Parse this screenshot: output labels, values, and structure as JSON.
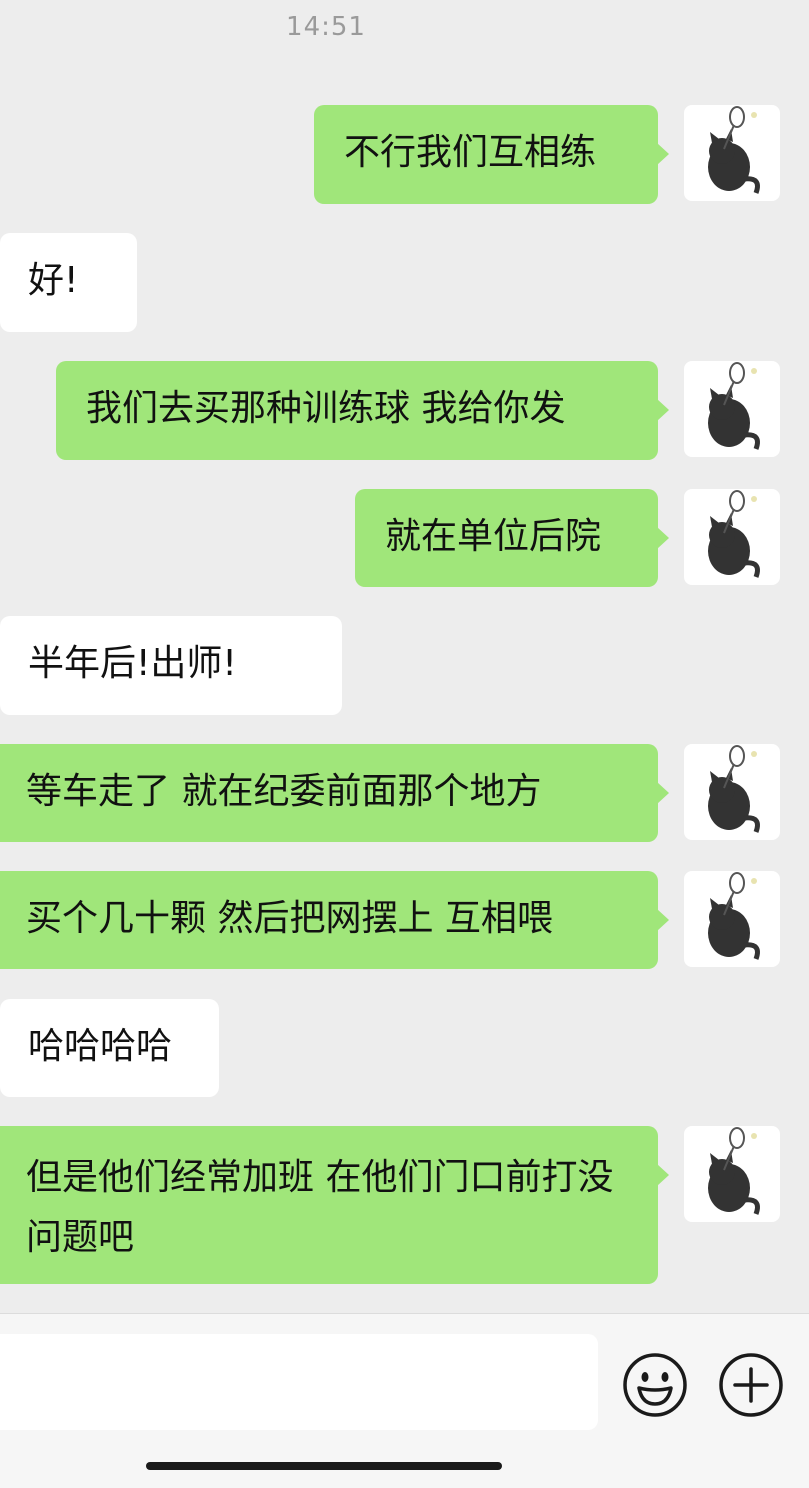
{
  "chat": {
    "timestamp": "14:51",
    "messages": [
      {
        "side": "right",
        "text": "不行我们互相练"
      },
      {
        "side": "left",
        "text": "好!"
      },
      {
        "side": "right",
        "text": "我们去买那种训练球 我给你发"
      },
      {
        "side": "right",
        "text": "就在单位后院"
      },
      {
        "side": "left",
        "text": "半年后!出师!"
      },
      {
        "side": "right",
        "text": "等车走了 就在纪委前面那个地方"
      },
      {
        "side": "right",
        "text": "买个几十颗 然后把网摆上 互相喂"
      },
      {
        "side": "left",
        "text": "哈哈哈哈"
      },
      {
        "side": "right",
        "text": "但是他们经常加班 在他们门口前打没问题吧"
      }
    ]
  },
  "input_bar": {
    "text_value": "",
    "emoji_icon": "smiley-face-icon",
    "more_icon": "plus-circle-icon"
  },
  "colors": {
    "background": "#ededed",
    "sent_bubble": "#a0e67a",
    "received_bubble": "#ffffff",
    "timestamp_text": "#9a9a9a"
  }
}
